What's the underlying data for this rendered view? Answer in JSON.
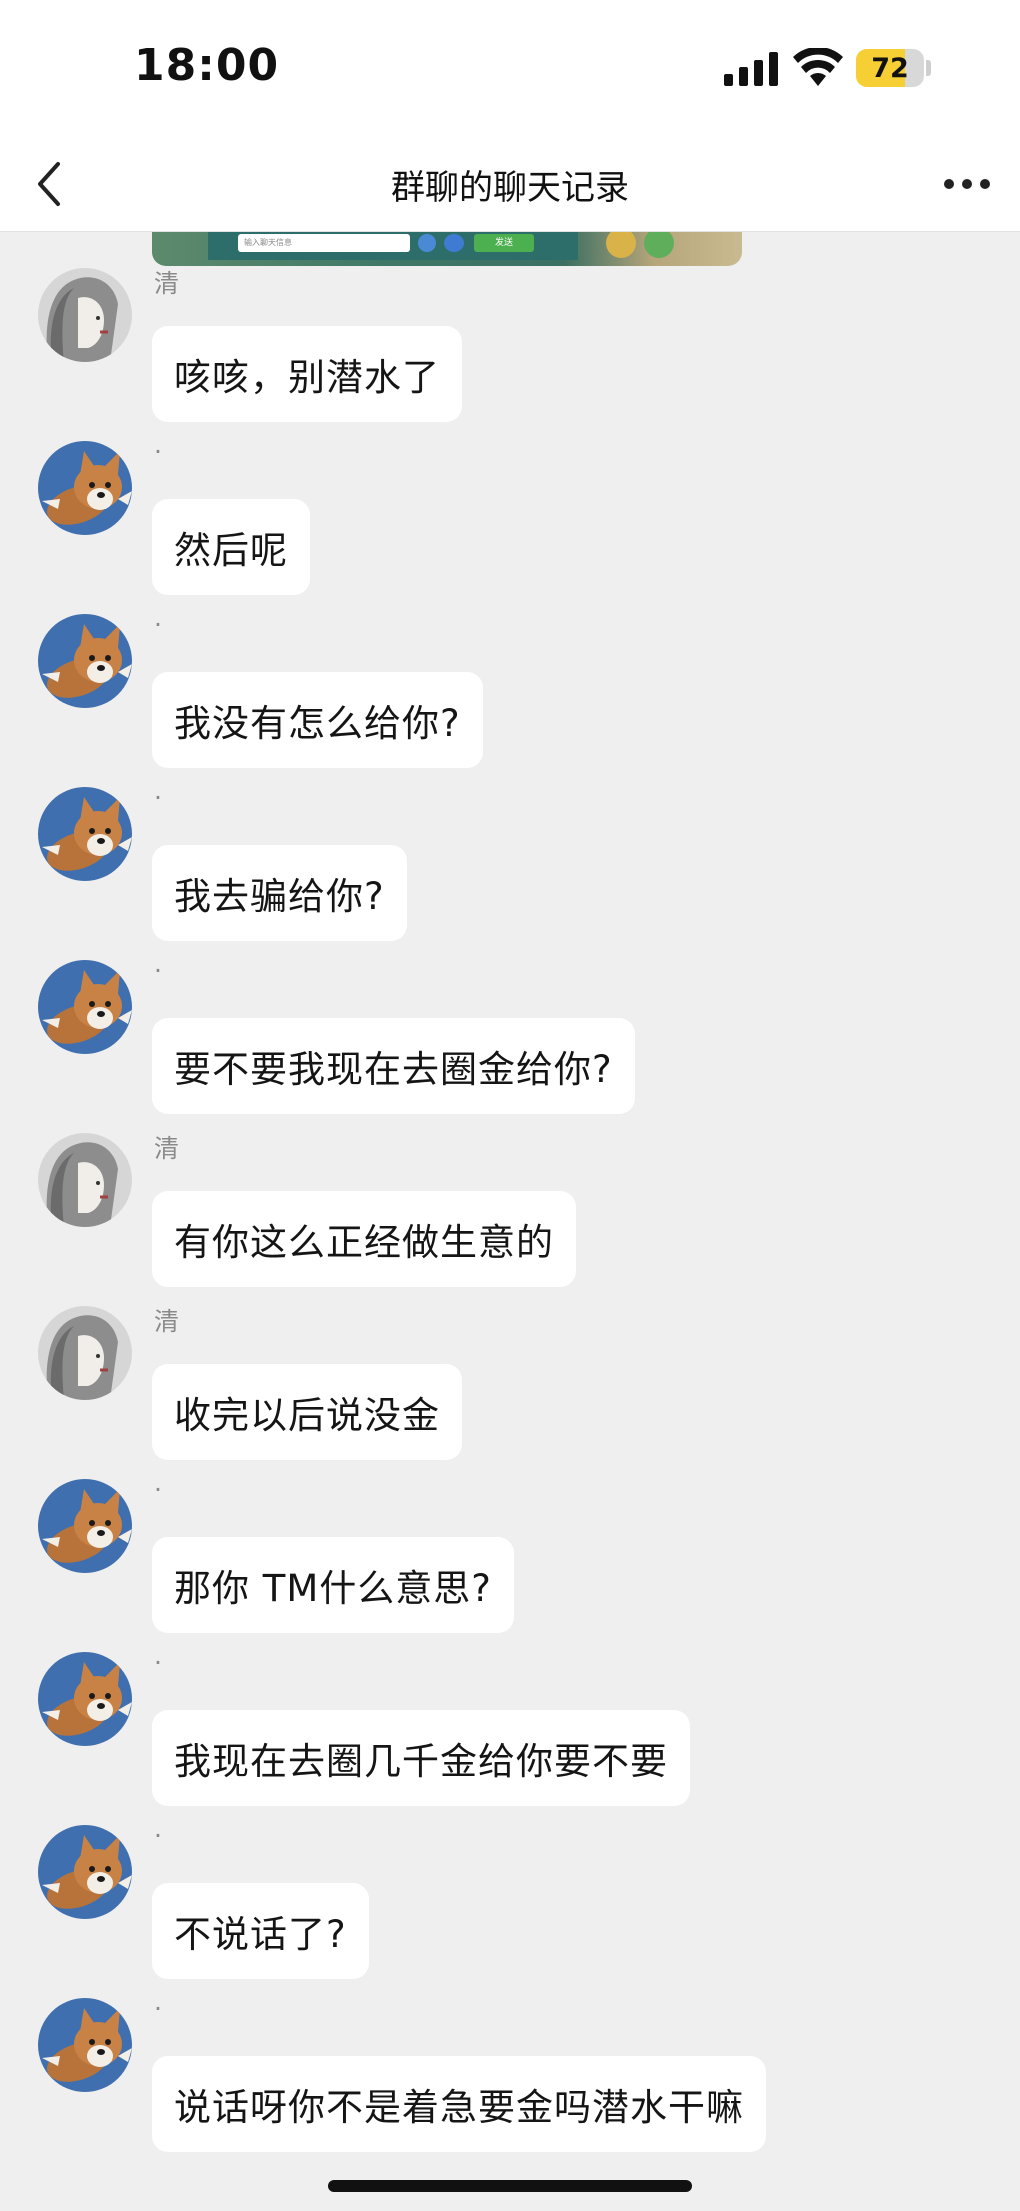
{
  "status_bar": {
    "time": "18:00",
    "battery": "72",
    "battery_level": 0.72
  },
  "nav": {
    "title": "群聊的聊天记录"
  },
  "image_preview": {
    "input_placeholder": "输入聊天信息",
    "send_label": "发送"
  },
  "messages": [
    {
      "sender": "清",
      "text": "咳咳，别潜水了",
      "avatar": "girl-sketch"
    },
    {
      "sender": "·",
      "text": "然后呢",
      "avatar": "corgi"
    },
    {
      "sender": "·",
      "text": "我没有怎么给你?",
      "avatar": "corgi"
    },
    {
      "sender": "·",
      "text": "我去骗给你?",
      "avatar": "corgi"
    },
    {
      "sender": "·",
      "text": "要不要我现在去圈金给你?",
      "avatar": "corgi"
    },
    {
      "sender": "清",
      "text": "有你这么正经做生意的",
      "avatar": "girl-sketch"
    },
    {
      "sender": "清",
      "text": "收完以后说没金",
      "avatar": "girl-sketch"
    },
    {
      "sender": "·",
      "text": "那你 TM什么意思?",
      "avatar": "corgi"
    },
    {
      "sender": "·",
      "text": "我现在去圈几千金给你要不要",
      "avatar": "corgi"
    },
    {
      "sender": "·",
      "text": "不说话了?",
      "avatar": "corgi"
    },
    {
      "sender": "·",
      "text": "说话呀你不是着急要金吗潜水干嘛",
      "avatar": "corgi"
    }
  ],
  "colors": {
    "background": "#efefef",
    "bubble": "#ffffff",
    "battery": "#f5cf34"
  }
}
